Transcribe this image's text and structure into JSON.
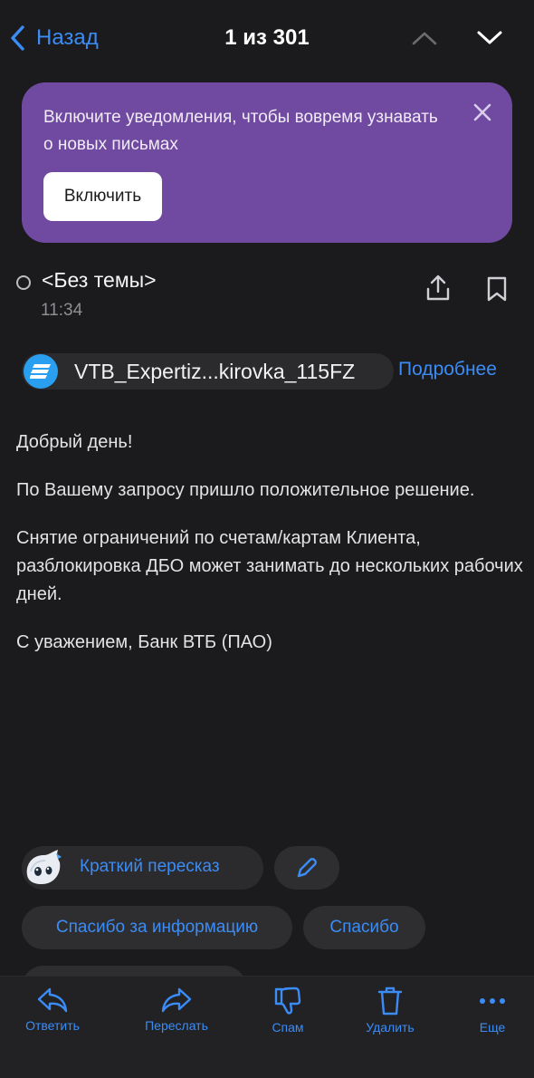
{
  "nav": {
    "back_label": "Назад",
    "counter": "1 из 301"
  },
  "banner": {
    "text": "Включите уведомления, чтобы вовремя узнавать о новых письмах",
    "button": "Включить"
  },
  "message": {
    "subject": "<Без темы>",
    "time": "11:34",
    "sender": "VTB_Expertiz...kirovka_115FZ",
    "details": "Подробнее",
    "paragraphs": [
      "Добрый день!",
      "По Вашему запросу пришло положительное решение.",
      "Снятие ограничений по счетам/картам Клиента, разблокировка ДБО может занимать до нескольких рабочих дней.",
      "С уважением, Банк ВТБ (ПАО)"
    ]
  },
  "smart": {
    "summary": "Краткий пересказ",
    "replies": [
      "Спасибо за информацию",
      "Спасибо",
      ""
    ]
  },
  "toolbar": {
    "reply": "Ответить",
    "forward": "Переслать",
    "spam": "Спам",
    "delete": "Удалить",
    "more": "Еще"
  },
  "colors": {
    "accent": "#3b8cf5",
    "background": "#1b1b1d",
    "banner": "#6f4aa0"
  }
}
